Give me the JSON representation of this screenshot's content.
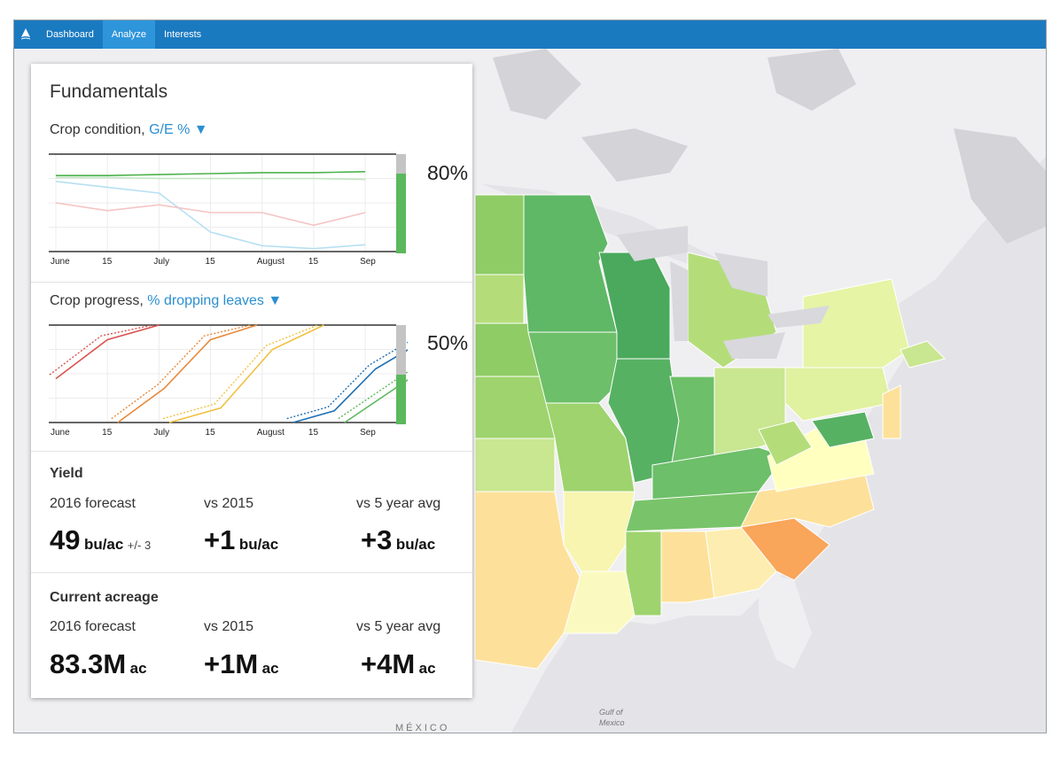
{
  "nav": {
    "items": [
      {
        "label": "Dashboard"
      },
      {
        "label": "Analyze"
      },
      {
        "label": "Interests"
      }
    ]
  },
  "panel": {
    "title": "Fundamentals",
    "crop_condition": {
      "label": "Crop condition,",
      "metric": "G/E % ▼",
      "value": "80%",
      "level": 0.8,
      "axis": [
        "June",
        "15",
        "July",
        "15",
        "August",
        "15",
        "Sep"
      ]
    },
    "crop_progress": {
      "label": "Crop progress,",
      "metric": "% dropping leaves ▼",
      "value": "50%",
      "level": 0.5,
      "axis": [
        "June",
        "15",
        "July",
        "15",
        "August",
        "15",
        "Sep"
      ]
    },
    "yield": {
      "title": "Yield",
      "c1_label": "2016 forecast",
      "c2_label": "vs 2015",
      "c3_label": "vs 5 year avg",
      "c1_value": "49",
      "c1_unit": "bu/ac",
      "c1_range": "+/- 3",
      "c2_value": "+1",
      "c2_unit": "bu/ac",
      "c3_value": "+3",
      "c3_unit": "bu/ac"
    },
    "acreage": {
      "title": "Current acreage",
      "c1_label": "2016 forecast",
      "c2_label": "vs 2015",
      "c3_label": "vs 5 year avg",
      "c1_value": "83.3M",
      "c1_unit": "ac",
      "c2_value": "+1M",
      "c2_unit": "ac",
      "c3_value": "+4M",
      "c3_unit": "ac"
    }
  },
  "map": {
    "labels": {
      "mexico": "MÉXICO",
      "gulf_1": "Gulf of",
      "gulf_2": "Mexico"
    }
  },
  "colors": {
    "topbar": "#1a7ac0",
    "active_tab": "#2e95db",
    "link": "#2b8fd0",
    "level_fill": "#5cb85c"
  },
  "chart_data": [
    {
      "type": "line",
      "title": "Crop condition, G/E %",
      "x": [
        "June",
        "15",
        "July",
        "15",
        "August",
        "15",
        "Sep"
      ],
      "ylim": [
        0,
        100
      ],
      "series": [
        {
          "color": "#4db34d",
          "values": [
            78,
            78,
            79,
            80,
            81,
            81,
            82
          ]
        },
        {
          "color": "#bfe5bf",
          "values": [
            76,
            76,
            75,
            75,
            75,
            75,
            74
          ]
        },
        {
          "color": "#b7e0f2",
          "values": [
            72,
            66,
            60,
            20,
            6,
            3,
            7
          ]
        },
        {
          "color": "#f5c4c4",
          "values": [
            50,
            42,
            48,
            40,
            40,
            27,
            40
          ]
        }
      ]
    },
    {
      "type": "line",
      "title": "Crop progress, % dropping leaves",
      "x": [
        "June",
        "15",
        "July",
        "15",
        "August",
        "15",
        "Sep"
      ],
      "ylim": [
        0,
        100
      ],
      "series": [
        {
          "color": "#d9534f",
          "values": [
            45,
            85,
            100
          ]
        },
        {
          "color": "#e8893a",
          "values": [
            0,
            35,
            85,
            100
          ]
        },
        {
          "color": "#f0c040",
          "values": [
            0,
            15,
            75,
            100
          ]
        },
        {
          "color": "#1f6fb2",
          "values": [
            0,
            12,
            55,
            80
          ]
        },
        {
          "color": "#5cb85c",
          "values": [
            0,
            25,
            50
          ]
        }
      ]
    }
  ]
}
